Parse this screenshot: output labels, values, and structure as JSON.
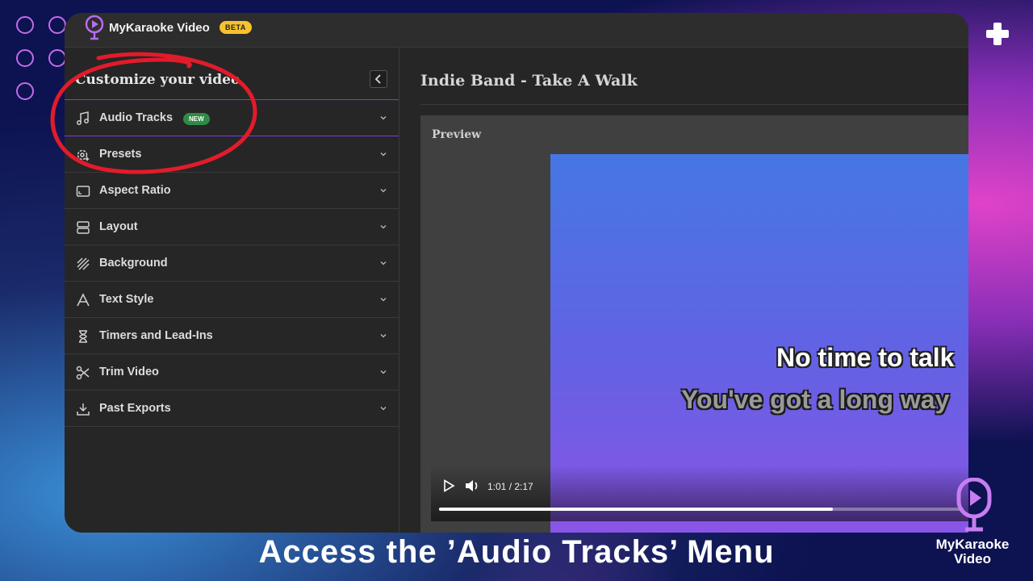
{
  "app": {
    "name": "MyKaraoke Video",
    "badge": "BETA"
  },
  "sidebar": {
    "title": "Customize your video",
    "items": [
      {
        "label": "Audio Tracks",
        "icon": "music-note-icon",
        "badge": "NEW",
        "active": true
      },
      {
        "label": "Presets",
        "icon": "gear-sparkle-icon"
      },
      {
        "label": "Aspect Ratio",
        "icon": "aspect-ratio-icon"
      },
      {
        "label": "Layout",
        "icon": "layout-icon"
      },
      {
        "label": "Background",
        "icon": "hatched-background-icon"
      },
      {
        "label": "Text Style",
        "icon": "text-style-icon"
      },
      {
        "label": "Timers and Lead-Ins",
        "icon": "hourglass-icon"
      },
      {
        "label": "Trim Video",
        "icon": "scissors-icon"
      },
      {
        "label": "Past Exports",
        "icon": "download-icon"
      }
    ]
  },
  "main": {
    "song_title": "Indie Band - Take A Walk",
    "preview_label": "Preview",
    "lyrics": {
      "line1": "No time to talk",
      "line2": "You've got a long way"
    },
    "player": {
      "time": "1:01 / 2:17",
      "progress": 0.75
    }
  },
  "overlay": {
    "caption": "Access the ’Audio Tracks’ Menu",
    "brand_line1": "MyKaraoke",
    "brand_line2": "Video"
  },
  "colors": {
    "accent": "#7c3aed",
    "annotation": "#e21b2b",
    "badge_new": "#2f8a46",
    "badge_beta": "#f7c22c"
  }
}
